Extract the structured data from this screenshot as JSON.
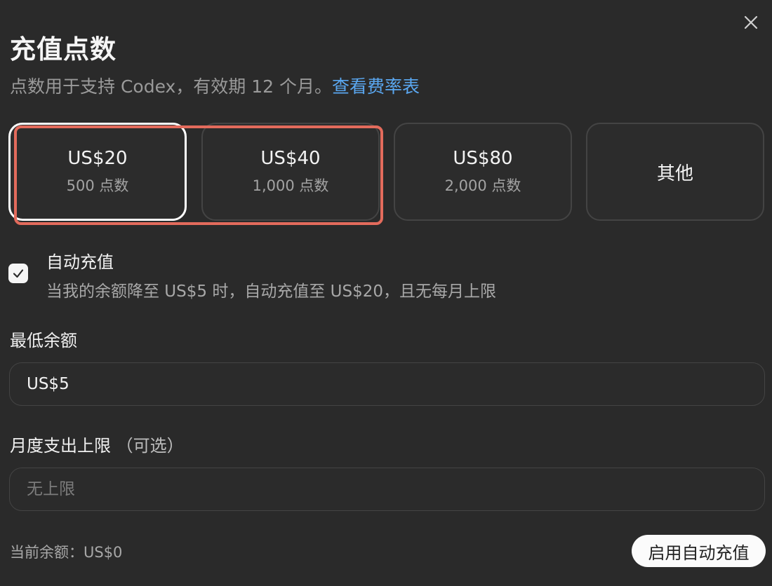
{
  "dialog": {
    "title": "充值点数",
    "subtitle_prefix": "点数用于支持 Codex，有效期 12 个月。",
    "rate_link": "查看费率表",
    "close_icon": "close-icon"
  },
  "options": [
    {
      "price": "US$20",
      "points": "500 点数",
      "selected": true
    },
    {
      "price": "US$40",
      "points": "1,000 点数",
      "selected": false
    },
    {
      "price": "US$80",
      "points": "2,000 点数",
      "selected": false
    },
    {
      "label": "其他",
      "selected": false
    }
  ],
  "auto_recharge": {
    "checked": true,
    "title": "自动充值",
    "description": "当我的余额降至 US$5 时，自动充值至 US$20，且无每月上限"
  },
  "min_balance": {
    "label": "最低余额",
    "value": "US$5"
  },
  "monthly_limit": {
    "label": "月度支出上限",
    "optional": "（可选）",
    "placeholder": "无上限",
    "value": ""
  },
  "footer": {
    "balance": "当前余额：US$0",
    "enable_button": "启用自动充值"
  },
  "colors": {
    "background": "#2a2a2a",
    "link": "#5aa7f0",
    "highlight": "#e36b5c"
  }
}
